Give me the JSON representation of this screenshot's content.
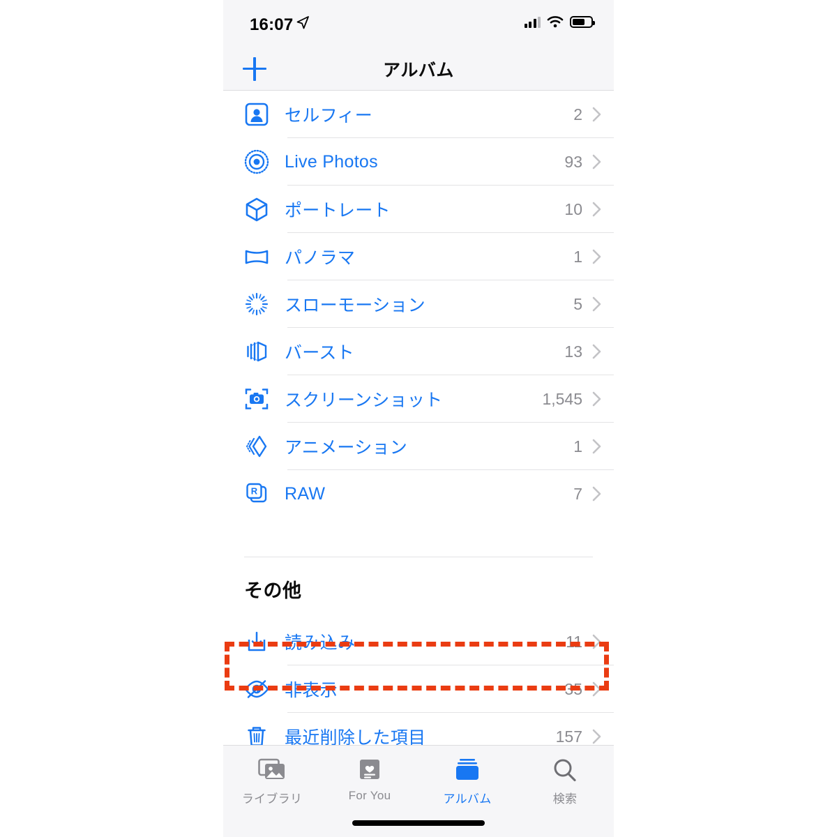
{
  "status_bar": {
    "time": "16:07",
    "location_icon": "location-arrow-icon",
    "signal_icon": "cellular-signal-icon",
    "wifi_icon": "wifi-icon",
    "battery_icon": "battery-icon"
  },
  "nav": {
    "title": "アルバム",
    "add_icon": "plus-icon"
  },
  "media_types": {
    "rows": [
      {
        "icon": "selfie-icon",
        "label": "セルフィー",
        "count": "2"
      },
      {
        "icon": "live-photos-icon",
        "label": "Live Photos",
        "count": "93"
      },
      {
        "icon": "portrait-icon",
        "label": "ポートレート",
        "count": "10"
      },
      {
        "icon": "panorama-icon",
        "label": "パノラマ",
        "count": "1"
      },
      {
        "icon": "slow-motion-icon",
        "label": "スローモーション",
        "count": "5"
      },
      {
        "icon": "burst-icon",
        "label": "バースト",
        "count": "13"
      },
      {
        "icon": "screenshot-icon",
        "label": "スクリーンショット",
        "count": "1,545"
      },
      {
        "icon": "animation-icon",
        "label": "アニメーション",
        "count": "1"
      },
      {
        "icon": "raw-icon",
        "label": "RAW",
        "count": "7"
      }
    ]
  },
  "other_section": {
    "header": "その他",
    "rows": [
      {
        "icon": "import-icon",
        "label": "読み込み",
        "count": "11"
      },
      {
        "icon": "eye-slash-icon",
        "label": "非表示",
        "count": "35"
      },
      {
        "icon": "trash-icon",
        "label": "最近削除した項目",
        "count": "157"
      }
    ]
  },
  "highlight": {
    "target_label": "非表示",
    "color": "#ea3c12",
    "style": "dashed-rectangle"
  },
  "tab_bar": {
    "tabs": [
      {
        "icon": "photos-library-icon",
        "label": "ライブラリ",
        "active": false
      },
      {
        "icon": "for-you-icon",
        "label": "For You",
        "active": false
      },
      {
        "icon": "albums-icon",
        "label": "アルバム",
        "active": true
      },
      {
        "icon": "search-icon",
        "label": "検索",
        "active": false
      }
    ]
  },
  "colors": {
    "accent": "#1877f2",
    "highlight": "#ea3c12",
    "count_text": "#8b8b90",
    "bar_background": "#f6f6f8"
  }
}
